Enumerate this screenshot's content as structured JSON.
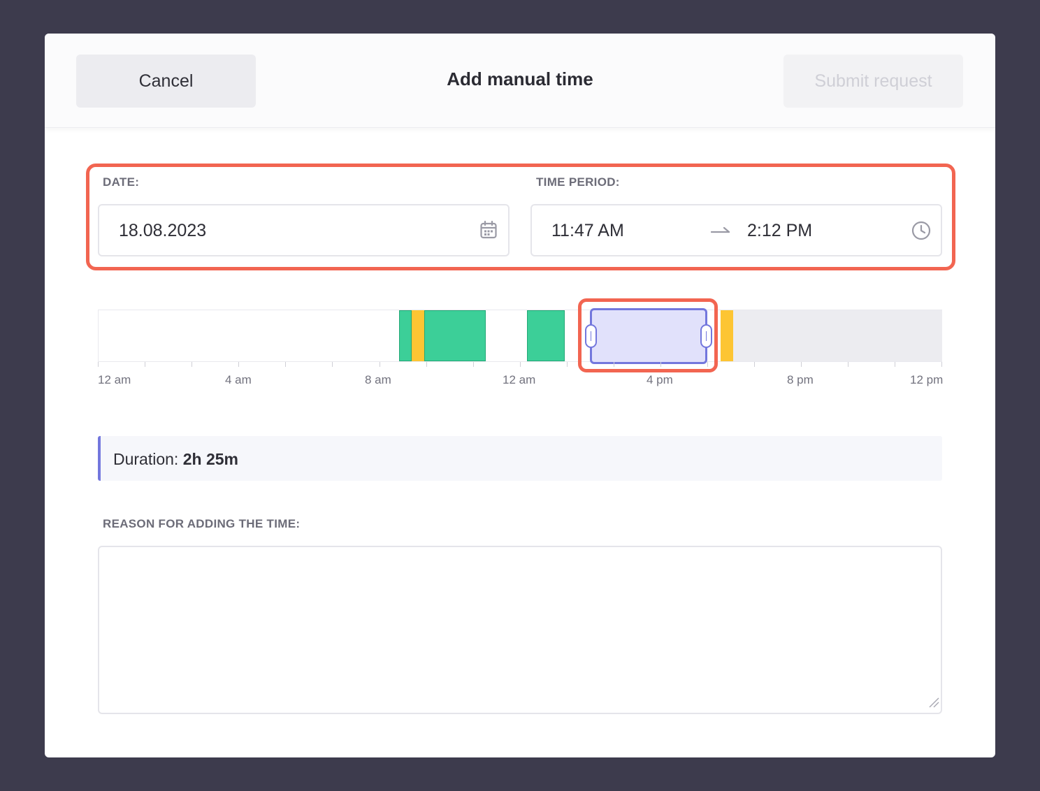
{
  "header": {
    "cancel_label": "Cancel",
    "title": "Add manual time",
    "submit_label": "Submit request"
  },
  "date": {
    "label": "DATE:",
    "value": "18.08.2023",
    "icon": "calendar-icon"
  },
  "time_period": {
    "label": "TIME PERIOD:",
    "start": "11:47 AM",
    "end": "2:12 PM",
    "separator_icon": "arrow-right-icon",
    "icon": "clock-icon"
  },
  "timeline": {
    "axis_labels": [
      "12 am",
      "4 am",
      "8 am",
      "12 am",
      "4 pm",
      "8 pm",
      "12 pm"
    ],
    "colors": {
      "tracked": "#3ccf98",
      "idle": "#fdc533",
      "selection": "#e1e1fb",
      "selection_border": "#7377dd",
      "unavailable": "#ececf0"
    }
  },
  "duration": {
    "label": "Duration:",
    "value": "2h 25m"
  },
  "reason": {
    "label": "REASON FOR ADDING THE TIME:",
    "value": "",
    "placeholder": ""
  },
  "accent_color": "#f26551"
}
